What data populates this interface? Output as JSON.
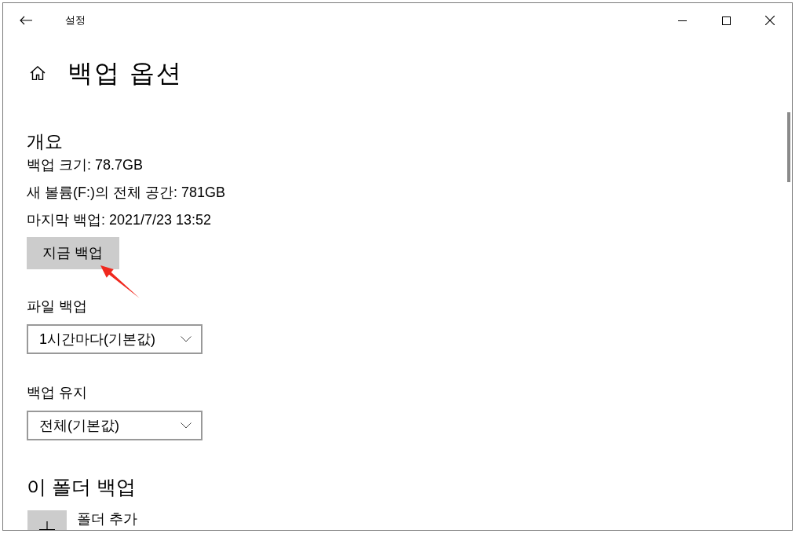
{
  "window": {
    "title": "설정"
  },
  "page": {
    "title": "백업 옵션"
  },
  "overview": {
    "heading": "개요",
    "lines": [
      "백업 크기: 78.7GB",
      "새 볼륨(F:)의 전체 공간: 781GB",
      "마지막 백업: 2021/7/23 13:52"
    ],
    "button": "지금 백업"
  },
  "settings": [
    {
      "label": "파일 백업",
      "value": "1시간마다(기본값)"
    },
    {
      "label": "백업 유지",
      "value": "전체(기본값)"
    }
  ],
  "folders": {
    "heading": "이 폴더 백업",
    "add_label": "폴더 추가"
  }
}
